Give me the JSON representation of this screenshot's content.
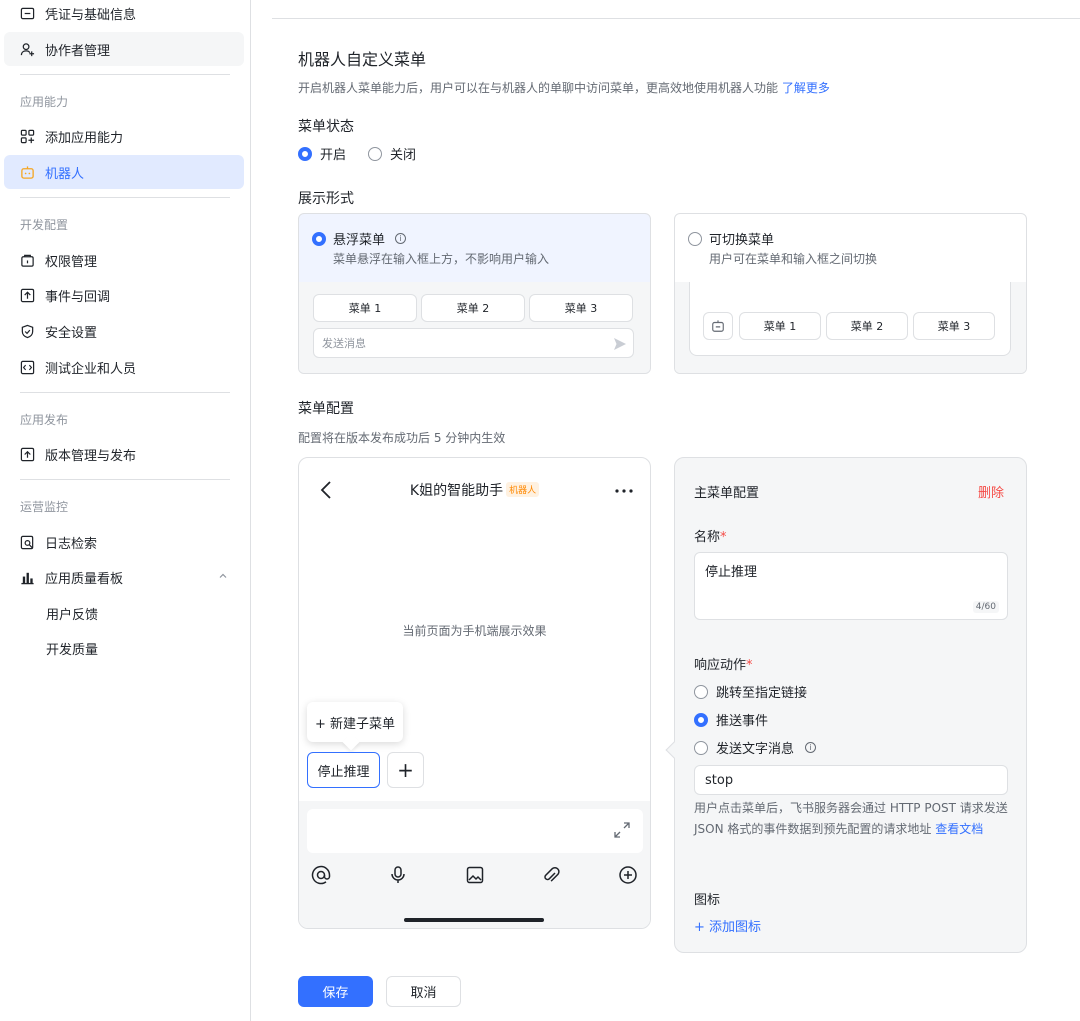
{
  "sidebar": {
    "items_top": [
      {
        "label": "凭证与基础信息",
        "icon": "credential-icon"
      },
      {
        "label": "协作者管理",
        "icon": "user-add-icon"
      }
    ],
    "sections": {
      "app_ability": "应用能力",
      "dev_config": "开发配置",
      "app_release": "应用发布",
      "ops_monitor": "运营监控"
    },
    "items_ability": [
      {
        "label": "添加应用能力",
        "icon": "apps-icon"
      },
      {
        "label": "机器人",
        "icon": "robot-icon"
      }
    ],
    "items_dev": [
      {
        "label": "权限管理",
        "icon": "permission-icon"
      },
      {
        "label": "事件与回调",
        "icon": "event-icon"
      },
      {
        "label": "安全设置",
        "icon": "shield-icon"
      },
      {
        "label": "测试企业和人员",
        "icon": "test-icon"
      }
    ],
    "items_release": [
      {
        "label": "版本管理与发布",
        "icon": "upload-icon"
      }
    ],
    "items_ops": [
      {
        "label": "日志检索",
        "icon": "log-search-icon"
      },
      {
        "label": "应用质量看板",
        "icon": "chart-icon"
      },
      {
        "label": "用户反馈"
      },
      {
        "label": "开发质量"
      }
    ]
  },
  "main": {
    "title": "机器人自定义菜单",
    "desc": "开启机器人菜单能力后，用户可以在与机器人的单聊中访问菜单，更高效地使用机器人功能",
    "learn_more": "了解更多",
    "menu_status_label": "菜单状态",
    "status_on": "开启",
    "status_off": "关闭",
    "display_label": "展示形式",
    "display_options": [
      {
        "title": "悬浮菜单",
        "sub": "菜单悬浮在输入框上方，不影响用户输入",
        "menus": [
          "菜单 1",
          "菜单 2",
          "菜单 3"
        ],
        "send_placeholder": "发送消息"
      },
      {
        "title": "可切换菜单",
        "sub": "用户可在菜单和输入框之间切换",
        "menus": [
          "菜单 1",
          "菜单 2",
          "菜单 3"
        ]
      }
    ],
    "config_label": "菜单配置",
    "config_desc": "配置将在版本发布成功后 5 分钟内生效"
  },
  "phone": {
    "title": "K姐的智能助手",
    "bot_tag": "机器人",
    "center_text": "当前页面为手机端展示效果",
    "new_submenu": "+ 新建子菜单",
    "menu_item": "停止推理",
    "add": "+"
  },
  "config": {
    "title": "主菜单配置",
    "delete": "删除",
    "name_label": "名称",
    "name_value": "停止推理",
    "name_count": "4/60",
    "action_label": "响应动作",
    "actions": [
      "跳转至指定链接",
      "推送事件",
      "发送文字消息"
    ],
    "event_value": "stop",
    "help": "用户点击菜单后，飞书服务器会通过 HTTP POST 请求发送 JSON 格式的事件数据到预先配置的请求地址",
    "help_link": "查看文档",
    "icon_label": "图标",
    "add_icon": "+ 添加图标"
  },
  "footer": {
    "save": "保存",
    "cancel": "取消"
  }
}
